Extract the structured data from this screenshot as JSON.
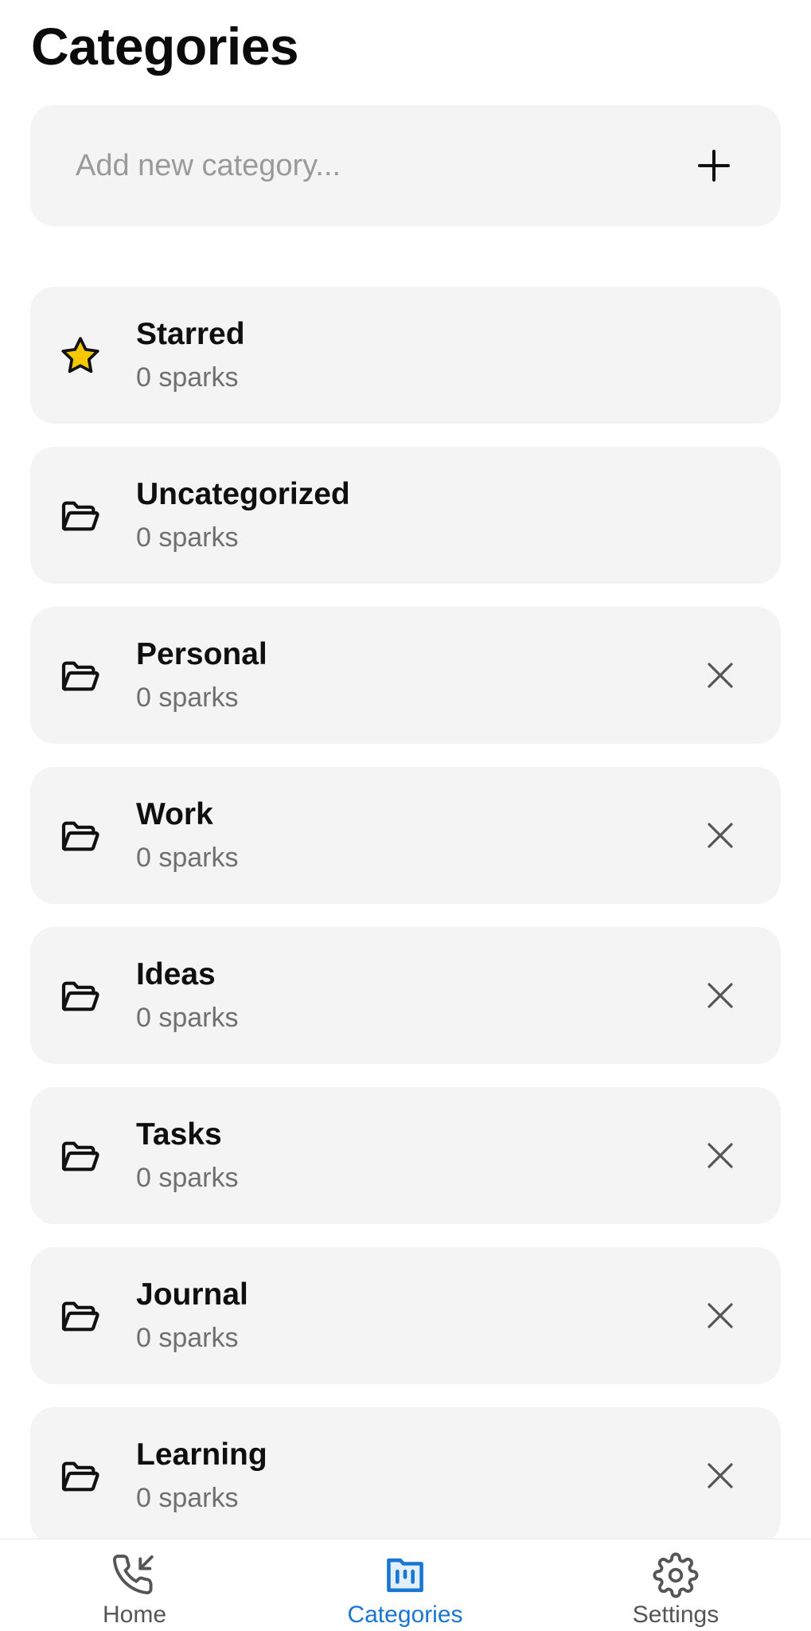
{
  "header": {
    "title": "Categories"
  },
  "add_category": {
    "placeholder": "Add new category..."
  },
  "categories": [
    {
      "name": "Starred",
      "count": "0 sparks",
      "icon": "star-icon"
    },
    {
      "name": "Uncategorized",
      "count": "0 sparks",
      "icon": "folder-open-icon"
    },
    {
      "name": "Personal",
      "count": "0 sparks",
      "icon": "folder-open-icon"
    },
    {
      "name": "Work",
      "count": "0 sparks",
      "icon": "folder-open-icon"
    },
    {
      "name": "Ideas",
      "count": "0 sparks",
      "icon": "folder-open-icon"
    },
    {
      "name": "Tasks",
      "count": "0 sparks",
      "icon": "folder-open-icon"
    },
    {
      "name": "Journal",
      "count": "0 sparks",
      "icon": "folder-open-icon"
    },
    {
      "name": "Learning",
      "count": "0 sparks",
      "icon": "folder-open-icon"
    }
  ],
  "nav": {
    "items": [
      {
        "label": "Home",
        "icon": "phone-incoming-icon"
      },
      {
        "label": "Categories",
        "icon": "category-board-icon",
        "active": true
      },
      {
        "label": "Settings",
        "icon": "gear-icon"
      }
    ]
  },
  "colors": {
    "accent": "#1976d2",
    "star": "#f5c800",
    "card": "#f4f4f4"
  }
}
